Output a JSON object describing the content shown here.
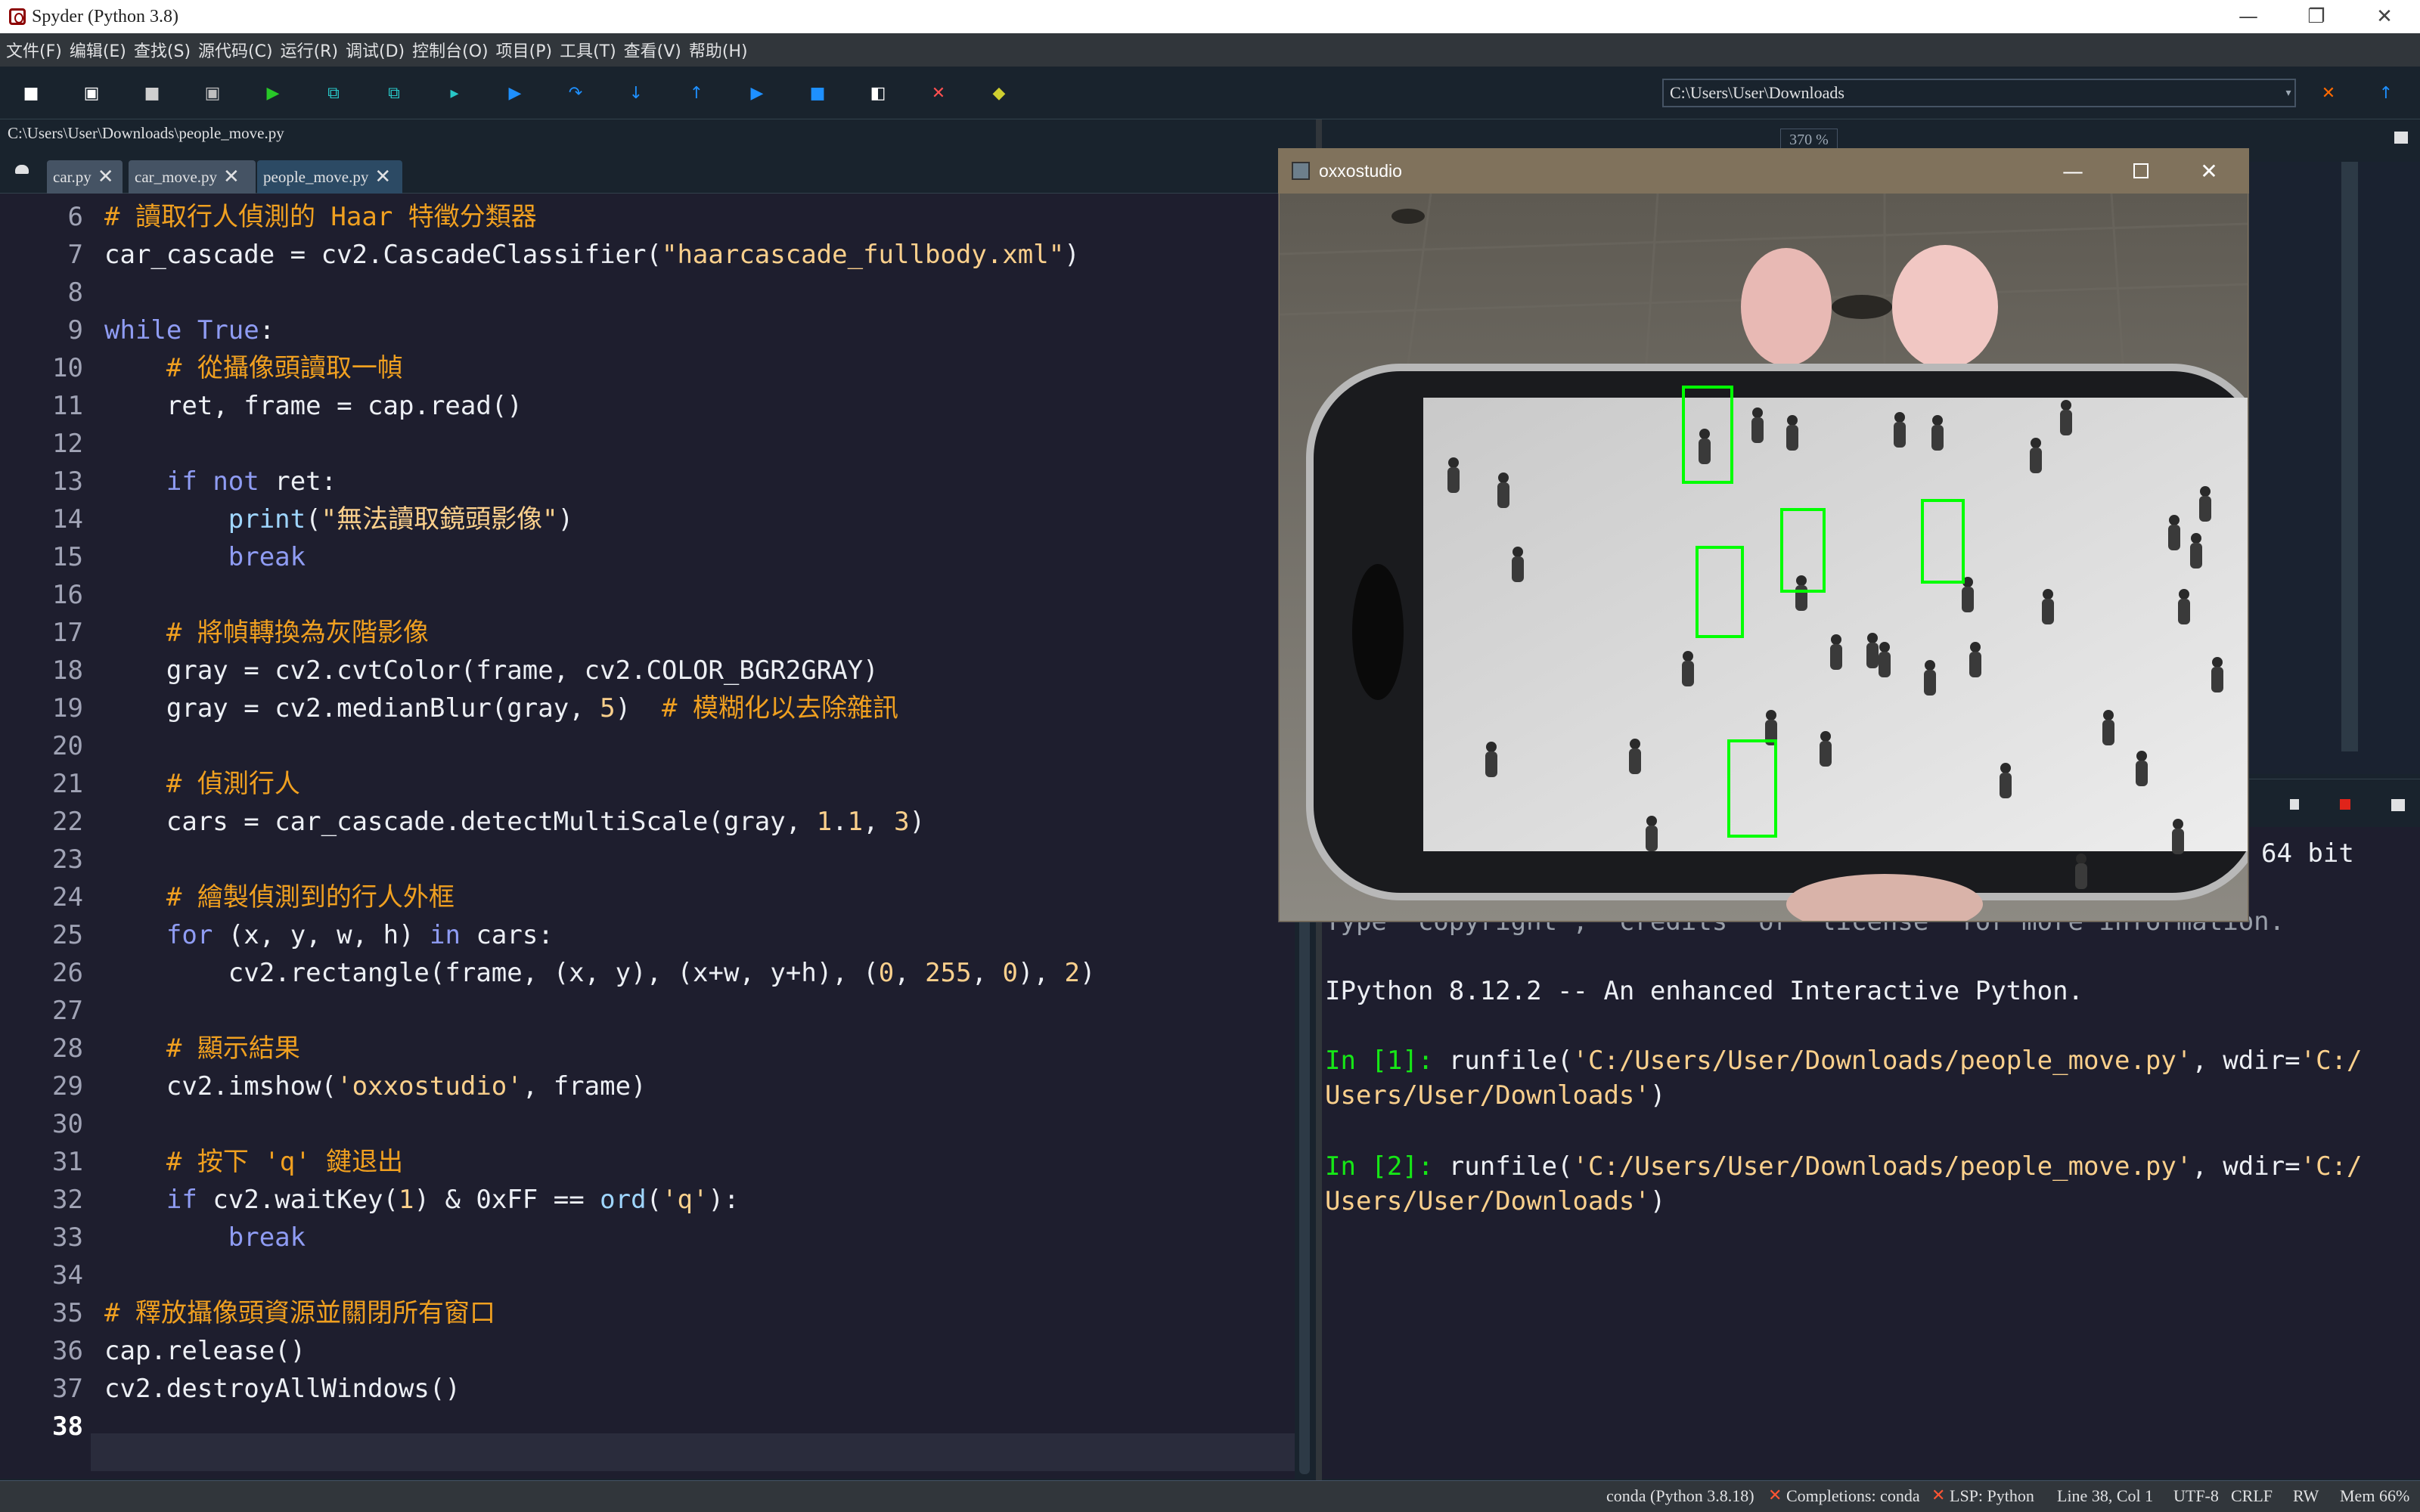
{
  "app": {
    "title": "Spyder (Python 3.8)"
  },
  "window_controls": {
    "minimize": "—",
    "maximize": "❐",
    "close": "✕"
  },
  "menu": [
    "文件(F)",
    "编辑(E)",
    "查找(S)",
    "源代码(C)",
    "运行(R)",
    "调试(D)",
    "控制台(O)",
    "项目(P)",
    "工具(T)",
    "查看(V)",
    "帮助(H)"
  ],
  "toolbar": {
    "icons": [
      "new-file-icon",
      "open-file-icon",
      "save-icon",
      "save-all-icon",
      "run-icon",
      "run-cell-icon",
      "run-cell-advance-icon",
      "run-selection-icon",
      "debug-icon",
      "step-icon",
      "step-into-icon",
      "step-return-icon",
      "continue-icon",
      "stop-debug-icon",
      "maximize-pane-icon",
      "preferences-icon",
      "python-path-icon"
    ],
    "working_dir": "C:\\Users\\User\\Downloads"
  },
  "editor": {
    "file_path": "C:\\Users\\User\\Downloads\\people_move.py",
    "tabs": [
      {
        "label": "car.py",
        "active": false
      },
      {
        "label": "car_move.py",
        "active": false
      },
      {
        "label": "people_move.py",
        "active": true
      }
    ],
    "line_numbers": [
      "6",
      "7",
      "8",
      "9",
      "10",
      "11",
      "12",
      "13",
      "14",
      "15",
      "16",
      "17",
      "18",
      "19",
      "20",
      "21",
      "22",
      "23",
      "24",
      "25",
      "26",
      "27",
      "28",
      "29",
      "30",
      "31",
      "32",
      "33",
      "34",
      "35",
      "36",
      "37",
      "38"
    ],
    "current_line": "38",
    "code": [
      "# 讀取行人偵測的 Haar 特徵分類器",
      "car_cascade = cv2.CascadeClassifier(\"haarcascade_fullbody.xml\")",
      "",
      "while True:",
      "    # 從攝像頭讀取一幀",
      "    ret, frame = cap.read()",
      "",
      "    if not ret:",
      "        print(\"無法讀取鏡頭影像\")",
      "        break",
      "",
      "    # 將幀轉換為灰階影像",
      "    gray = cv2.cvtColor(frame, cv2.COLOR_BGR2GRAY)",
      "    gray = cv2.medianBlur(gray, 5)  # 模糊化以去除雜訊",
      "",
      "    # 偵測行人",
      "    cars = car_cascade.detectMultiScale(gray, 1.1, 3)",
      "",
      "    # 繪製偵測到的行人外框",
      "    for (x, y, w, h) in cars:",
      "        cv2.rectangle(frame, (x, y), (x+w, y+h), (0, 255, 0), 2)",
      "",
      "    # 顯示結果",
      "    cv2.imshow('oxxostudio', frame)",
      "",
      "    # 按下 'q' 鍵退出",
      "    if cv2.waitKey(1) & 0xFF == ord('q'):",
      "        break",
      "",
      "# 釋放攝像頭資源並關閉所有窗口",
      "cap.release()",
      "cv2.destroyAllWindows()",
      ""
    ]
  },
  "help": {
    "zoom": "370 %"
  },
  "console": {
    "banner_tail": "64 bit",
    "copyright_line": "Type \"copyright\", \"credits\" or \"license\" for more information.",
    "ipython_line": "IPython 8.12.2 -- An enhanced Interactive Python.",
    "inputs": [
      {
        "prompt": "In [1]:",
        "cmd": "runfile(",
        "arg1": "'C:/Users/User/Downloads/people_move.py'",
        "mid": ", wdir=",
        "arg2a": "'C:/",
        "arg2b": "Users/User/Downloads'",
        "end": ")"
      },
      {
        "prompt": "In [2]:",
        "cmd": "runfile(",
        "arg1": "'C:/Users/User/Downloads/people_move.py'",
        "mid": ", wdir=",
        "arg2a": "'C:/",
        "arg2b": "Users/User/Downloads'",
        "end": ")"
      }
    ]
  },
  "image_window": {
    "title": "oxxostudio"
  },
  "status": {
    "env": "conda (Python 3.8.18)",
    "completions": "Completions: conda",
    "lsp": "LSP: Python",
    "position": "Line 38, Col 1",
    "encoding": "UTF-8",
    "eol": "CRLF",
    "mode": "RW",
    "mem": "Mem 66%"
  },
  "colors": {
    "bg": "#19232d",
    "editor_bg": "#1e1e2e",
    "comment": "#f0a020",
    "keyword": "#8f9cf3",
    "string": "#fbd08c",
    "prompt": "#16e716",
    "detect_box": "#00ff00"
  }
}
